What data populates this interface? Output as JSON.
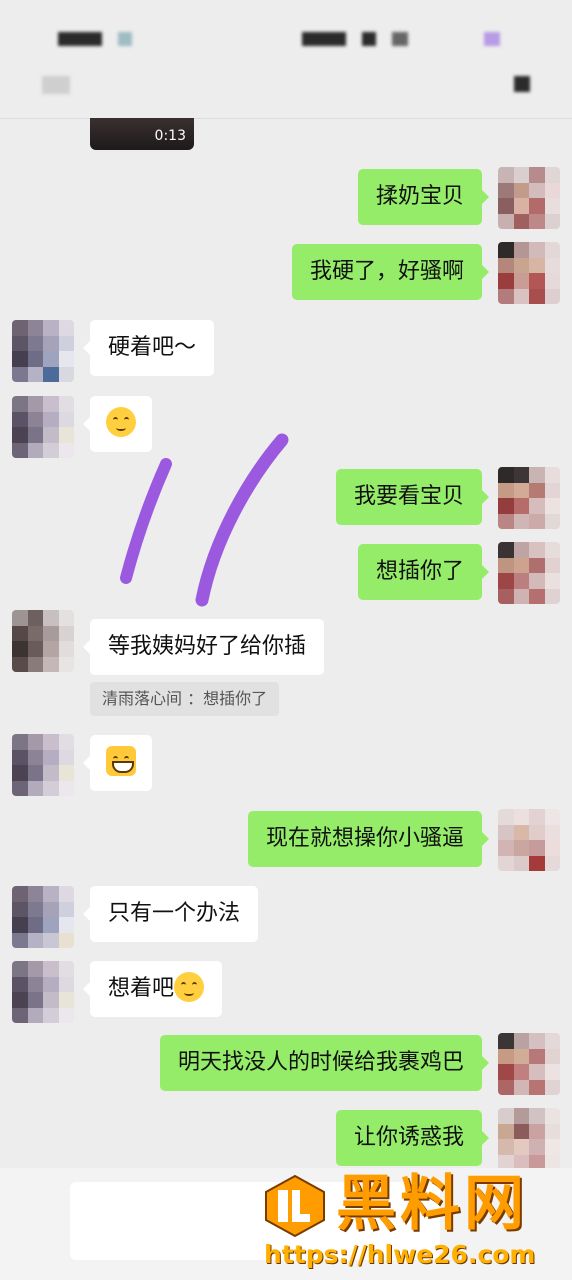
{
  "colors": {
    "bg": "#ededed",
    "outgoing": "#95ec69",
    "incoming": "#ffffff",
    "watermark": "#ff9d00"
  },
  "video": {
    "duration": "0:13"
  },
  "messages": [
    {
      "dir": "out",
      "text": "揉奶宝贝"
    },
    {
      "dir": "out",
      "text": "我硬了，好骚啊"
    },
    {
      "dir": "in",
      "text": "硬着吧～"
    },
    {
      "dir": "in",
      "text": "",
      "emoji": "blushing-smile-emoji"
    },
    {
      "dir": "out",
      "text": "我要看宝贝"
    },
    {
      "dir": "out",
      "text": "想插你了"
    },
    {
      "dir": "in",
      "text": "等我姨妈好了给你插"
    },
    {
      "dir": "in",
      "text": "",
      "emoji": "grinning-emoji"
    },
    {
      "dir": "out",
      "text": "现在就想操你小骚逼"
    },
    {
      "dir": "in",
      "text": "只有一个办法"
    },
    {
      "dir": "in",
      "text": "想着吧",
      "emoji": "blushing-smile-emoji"
    },
    {
      "dir": "out",
      "text": "明天找没人的时候给我裹鸡巴"
    },
    {
      "dir": "out",
      "text": "让你诱惑我"
    }
  ],
  "quote": {
    "text": "清雨落心间 ：想插你了"
  },
  "watermark": {
    "title": "黑料网",
    "url": "https://hlwe26.com"
  }
}
